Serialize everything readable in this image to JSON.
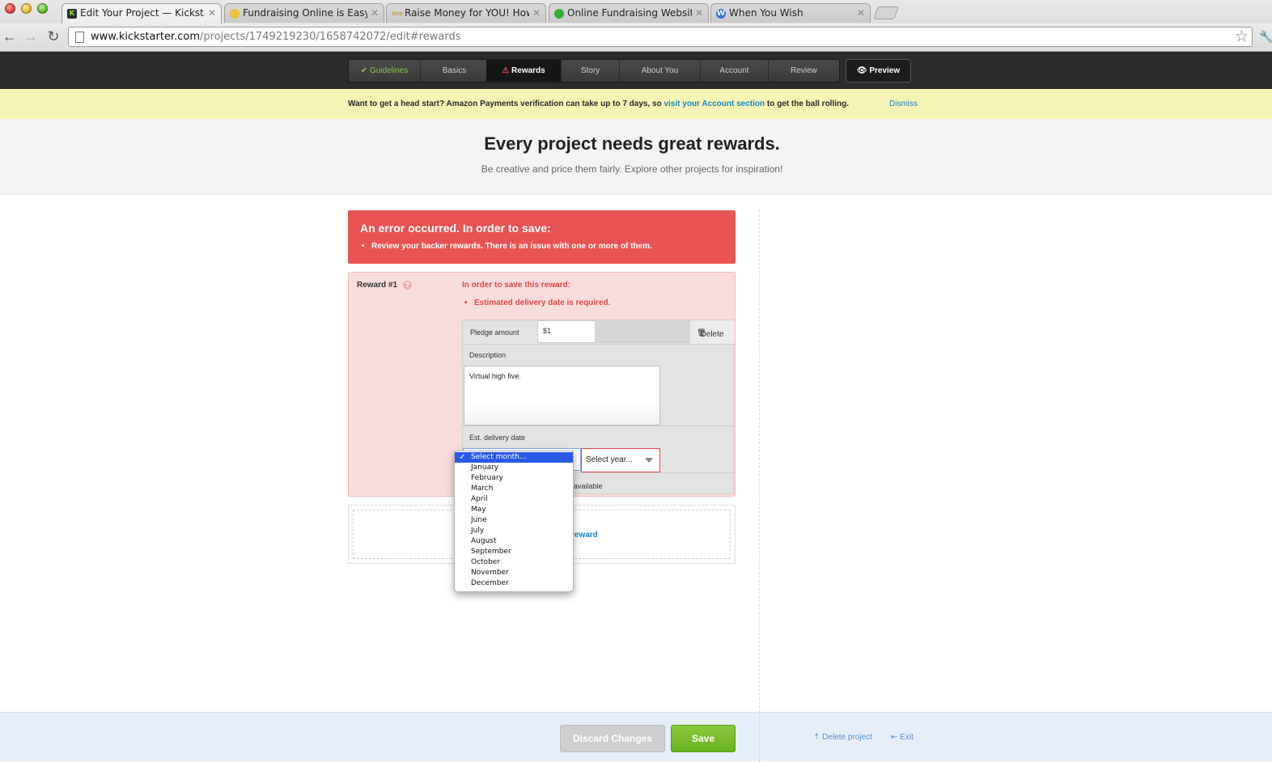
{
  "browser": {
    "tabs": [
      {
        "title": "Edit Your Project — Kickstart",
        "favicon": "K",
        "color": "#2b2b2b"
      },
      {
        "title": "Fundraising Online is Easy fo",
        "favicon": "",
        "color": "#e8c23a"
      },
      {
        "title": "Raise Money for YOU! How to",
        "favicon": "me",
        "color": "#c9a050"
      },
      {
        "title": "Online Fundraising Website a",
        "favicon": "",
        "color": "#2fae3a"
      },
      {
        "title": "When You Wish",
        "favicon": "W",
        "color": "#3b6fd4"
      }
    ],
    "url_host": "www.kickstarter.com",
    "url_path": "/projects/1749219230/1658742072/edit#rewards"
  },
  "steps": {
    "guidelines": "Guidelines",
    "basics": "Basics",
    "rewards": "Rewards",
    "story": "Story",
    "about": "About You",
    "account": "Account",
    "review": "Review",
    "preview": "Preview"
  },
  "notice": {
    "text_before": "Want to get a head start? Amazon Payments verification can take up to 7 days, so ",
    "link": "visit your Account section",
    "text_after": " to get the ball rolling.",
    "dismiss": "Dismiss"
  },
  "header": {
    "title": "Every project needs great rewards.",
    "subtitle": "Be creative and price them fairly. Explore other projects for inspiration!"
  },
  "error": {
    "title": "An error occurred. In order to save:",
    "item": "Review your backer rewards. There is an issue with one or more of them."
  },
  "reward": {
    "label": "Reward #1",
    "error_title": "In order to save this reward:",
    "error_item": "Estimated delivery date is required.",
    "pledge_label": "Pledge amount",
    "pledge_value": "$1",
    "delete": "Delete",
    "description_label": "Description",
    "description_value": "Virtual high five.",
    "delivery_label": "Est. delivery date",
    "year_placeholder": "Select year...",
    "limit_text": "available"
  },
  "month_options": [
    "Select month...",
    "January",
    "February",
    "March",
    "April",
    "May",
    "June",
    "July",
    "August",
    "September",
    "October",
    "November",
    "December"
  ],
  "add_reward": "reward",
  "footer": {
    "discard": "Discard Changes",
    "save": "Save",
    "delete_project": "Delete project",
    "exit": "Exit"
  }
}
